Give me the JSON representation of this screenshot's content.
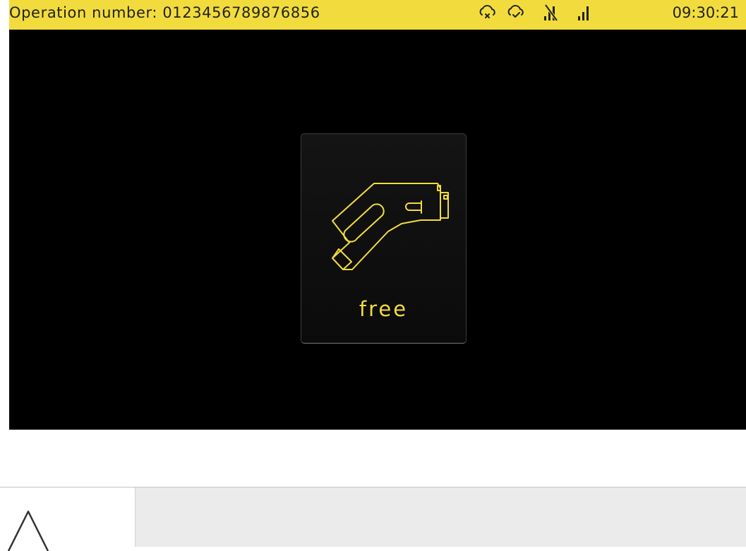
{
  "status_bar": {
    "operation_label": "Operation number:",
    "operation_number": "0123456789876856",
    "time": "09:30:21",
    "icons": [
      "cloud-disconnected-icon",
      "cloud-connected-icon",
      "no-network-signal-icon",
      "signal-strength-icon"
    ],
    "background_color": "#f2dc3d"
  },
  "gun": {
    "icon": "charging-plug-icon",
    "status": "free",
    "accent_color": "#f2dc3d"
  },
  "bottom_panel": {
    "icon": "warning-triangle-icon"
  }
}
